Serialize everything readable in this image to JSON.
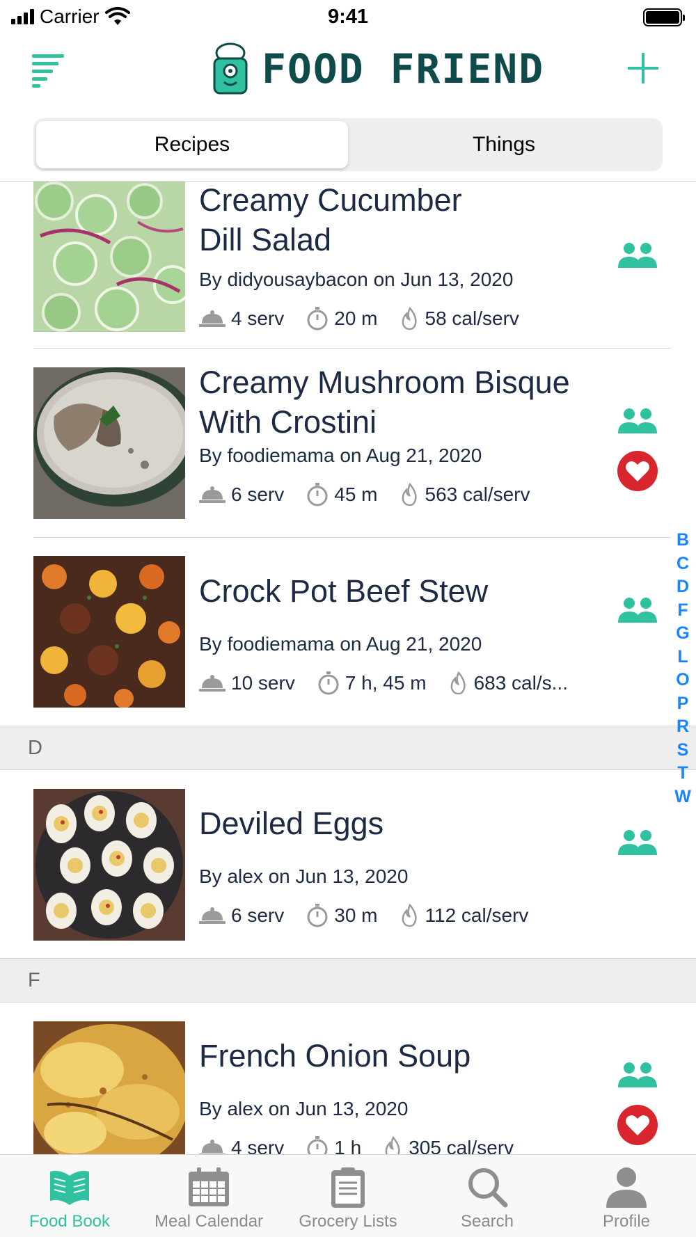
{
  "status_bar": {
    "carrier": "Carrier",
    "time": "9:41"
  },
  "header": {
    "app_name": "FOOD FRIEND"
  },
  "segments": [
    {
      "label": "Recipes",
      "active": true
    },
    {
      "label": "Things",
      "active": false
    }
  ],
  "recipes": [
    {
      "title_line1": "Creamy Cucumber",
      "title_line2": "Dill Salad",
      "byline": "By didyousaybacon on Jun 13, 2020",
      "servings": "4 serv",
      "time": "20 m",
      "calories": "58 cal/serv",
      "shared": true,
      "favorite": false
    },
    {
      "title_line1": "Creamy Mushroom Bisque",
      "title_line2": "With Crostini",
      "byline": "By foodiemama on Aug 21, 2020",
      "servings": "6 serv",
      "time": "45 m",
      "calories": "563 cal/serv",
      "shared": true,
      "favorite": true
    },
    {
      "title_line1": "Crock Pot Beef Stew",
      "byline": "By foodiemama on Aug 21, 2020",
      "servings": "10 serv",
      "time": "7 h, 45 m",
      "calories": "683 cal/s...",
      "shared": true,
      "favorite": false
    },
    {
      "title_line1": "Deviled Eggs",
      "byline": "By alex on Jun 13, 2020",
      "servings": "6 serv",
      "time": "30 m",
      "calories": "112 cal/serv",
      "shared": true,
      "favorite": false
    },
    {
      "title_line1": "French Onion Soup",
      "byline": "By alex on Jun 13, 2020",
      "servings": "4 serv",
      "time": "1 h",
      "calories": "305 cal/serv",
      "shared": true,
      "favorite": true
    }
  ],
  "sections": [
    "D",
    "F"
  ],
  "alpha_index": [
    "B",
    "C",
    "D",
    "F",
    "G",
    "L",
    "O",
    "P",
    "R",
    "S",
    "T",
    "W"
  ],
  "tabs": [
    {
      "label": "Food Book",
      "icon": "book-icon",
      "active": true
    },
    {
      "label": "Meal Calendar",
      "icon": "calendar-icon",
      "active": false
    },
    {
      "label": "Grocery Lists",
      "icon": "clipboard-icon",
      "active": false
    },
    {
      "label": "Search",
      "icon": "search-icon",
      "active": false
    },
    {
      "label": "Profile",
      "icon": "person-icon",
      "active": false
    }
  ],
  "colors": {
    "accent": "#2fc1a0",
    "heart": "#d9262e",
    "title_text": "#1d2a44",
    "index": "#1a84ff",
    "logo": "#0f4b4a"
  }
}
